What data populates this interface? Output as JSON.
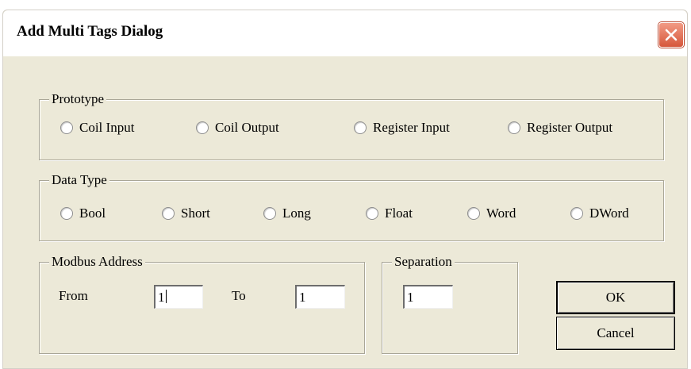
{
  "dialog": {
    "title": "Add Multi Tags Dialog"
  },
  "prototype": {
    "legend": "Prototype",
    "options": [
      "Coil Input",
      "Coil Output",
      "Register Input",
      "Register Output"
    ]
  },
  "data_type": {
    "legend": "Data Type",
    "options": [
      "Bool",
      "Short",
      "Long",
      "Float",
      "Word",
      "DWord"
    ]
  },
  "modbus_address": {
    "legend": "Modbus Address",
    "from_label": "From",
    "from_value": "1",
    "to_label": "To",
    "to_value": "1"
  },
  "separation": {
    "legend": "Separation",
    "value": "1"
  },
  "buttons": {
    "ok": "OK",
    "cancel": "Cancel"
  },
  "icons": {
    "close": "close-icon",
    "close_color": "#d6573b"
  }
}
